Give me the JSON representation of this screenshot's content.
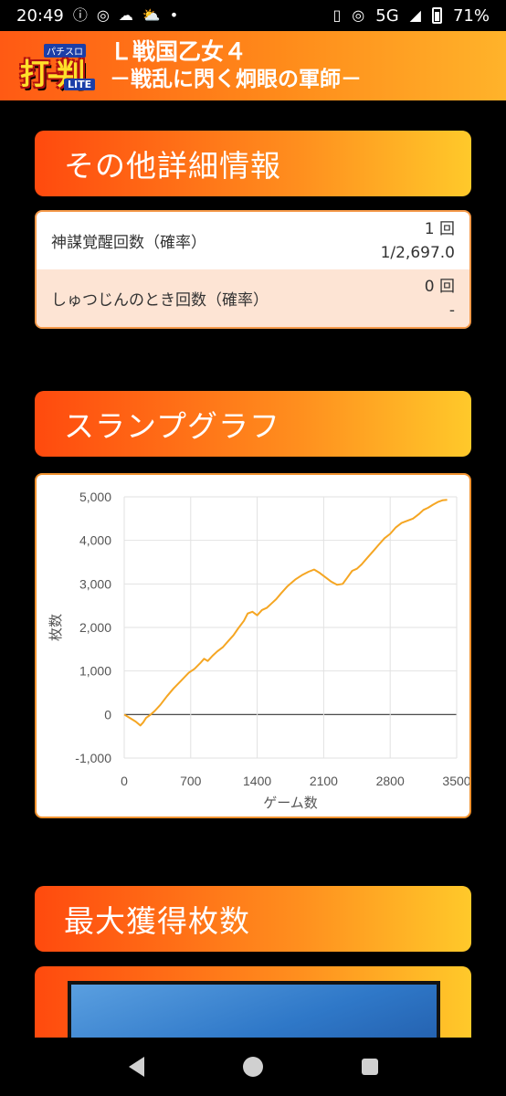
{
  "status_bar": {
    "time": "20:49",
    "network": "5G",
    "battery": "71%",
    "icons": [
      "info-icon",
      "hotspot-icon",
      "cloud-icon",
      "weather-icon",
      "dot-icon",
      "vibrate-icon",
      "hotspot-icon",
      "signal-icon",
      "battery-icon"
    ]
  },
  "header": {
    "logo_top": "パチスロ",
    "logo_main": "打-判",
    "logo_sub": "LITE",
    "title_line1": "Ｌ戦国乙女４",
    "title_line2": "－戦乱に閃く炯眼の軍師－"
  },
  "sections": {
    "details_title": "その他詳細情報",
    "graph_title": "スランプグラフ",
    "max_title": "最大獲得枚数"
  },
  "details": [
    {
      "label": "神謀覚醒回数（確率）",
      "count": "1 回",
      "prob": "1/2,697.0"
    },
    {
      "label": "しゅつじんのとき回数（確率）",
      "count": "0 回",
      "prob": "-"
    }
  ],
  "colors": {
    "accent": "#ff6a14",
    "line": "#f5a623"
  },
  "chart_data": {
    "type": "line",
    "xlabel": "ゲーム数",
    "ylabel": "枚数",
    "xlim": [
      0,
      3500
    ],
    "ylim": [
      -1000,
      5000
    ],
    "xticks": [
      "0",
      "700",
      "1400",
      "2100",
      "2800",
      "3500"
    ],
    "yticks": [
      "5,000",
      "4,000",
      "3,000",
      "2,000",
      "1,000",
      "0",
      "-1,000"
    ],
    "x": [
      0,
      60,
      120,
      170,
      200,
      230,
      280,
      320,
      380,
      450,
      520,
      600,
      680,
      740,
      800,
      840,
      880,
      930,
      980,
      1040,
      1100,
      1150,
      1200,
      1260,
      1300,
      1350,
      1400,
      1450,
      1500,
      1550,
      1600,
      1650,
      1720,
      1800,
      1870,
      1940,
      2000,
      2060,
      2120,
      2180,
      2240,
      2300,
      2350,
      2400,
      2450,
      2500,
      2560,
      2620,
      2680,
      2740,
      2800,
      2860,
      2920,
      2980,
      3040,
      3100,
      3150,
      3200,
      3250,
      3300,
      3350,
      3400
    ],
    "values": [
      0,
      -80,
      -160,
      -250,
      -180,
      -80,
      0,
      80,
      220,
      420,
      600,
      780,
      960,
      1050,
      1180,
      1280,
      1230,
      1350,
      1450,
      1550,
      1700,
      1820,
      1980,
      2150,
      2320,
      2360,
      2280,
      2400,
      2450,
      2550,
      2650,
      2780,
      2950,
      3100,
      3200,
      3280,
      3330,
      3250,
      3150,
      3050,
      2980,
      3000,
      3150,
      3300,
      3350,
      3450,
      3600,
      3750,
      3900,
      4050,
      4150,
      4300,
      4400,
      4450,
      4500,
      4600,
      4700,
      4750,
      4820,
      4880,
      4920,
      4930
    ]
  }
}
